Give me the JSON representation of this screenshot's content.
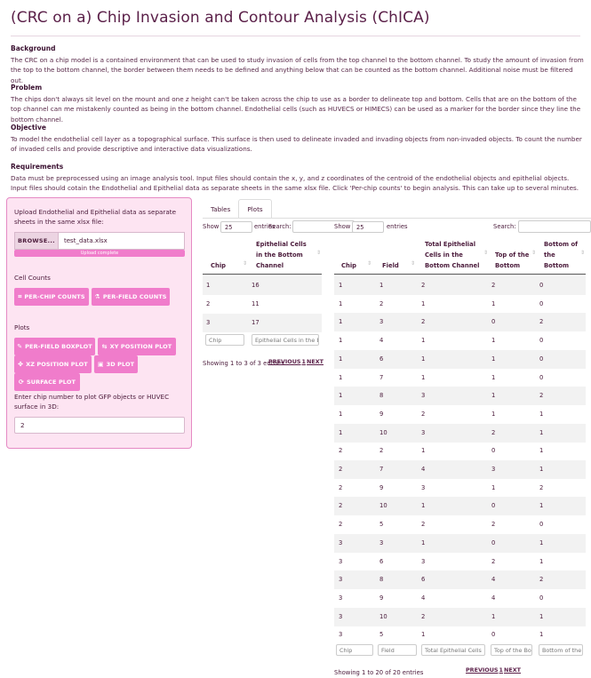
{
  "title": "(CRC on a) Chip Invasion and Contour Analysis (ChICA)",
  "sections": [
    {
      "heading": "Background",
      "text": "The CRC on a chip model is a contained environment that can be used to study invasion of cells from the top channel to the bottom channel. To study the amount of invasion from the top to the bottom channel, the border between them needs to be defined and anything below that can be counted as the bottom channel. Additional noise must be filtered out."
    },
    {
      "heading": "Problem",
      "text": "The chips don't always sit level on the mount and one z height can't be taken across the chip to use as a border to delineate top and bottom. Cells that are on the bottom of the top channel can me mistakenly counted as being in the bottom channel. Endothelial cells (such as HUVECS or HIMECS) can be used as a marker for the border since they line the bottom channel."
    },
    {
      "heading": "Objective",
      "text": "To model the endothelial cell layer as a topographical surface. This surface is then used to delineate invaded and invading objects from non-invaded objects. To count the number of invaded cells and provide descriptive and interactive data visualizations."
    },
    {
      "heading": "Requirements",
      "text": "Data must be preprocessed using an image analysis tool. Input files should contain the x, y, and z coordinates of the centroid of the endothelial objects and epithelial objects. Input files should cotain the Endothelial and Epithelial data as separate sheets in the same xlsx file. Click 'Per-chip counts' to begin analysis. This can take up to several minutes."
    }
  ],
  "sidebar": {
    "upload_label": "Upload Endothelial and Epithelial data as separate sheets in the same xlsx file:",
    "browse_label": "BROWSE...",
    "file_name": "test_data.xlsx",
    "progress_text": "Upload complete",
    "progress": 1.0,
    "cell_counts_label": "Cell Counts",
    "per_chip_label": "PER-CHIP COUNTS",
    "per_field_label": "PER-FIELD COUNTS",
    "plots_label": "Plots",
    "boxplot_label": "PER-FIELD BOXPLOT",
    "xy_label": "XY POSITION PLOT",
    "xz_label": "XZ POSITION PLOT",
    "plot3d_label": "3D PLOT",
    "surface_label": "SURFACE PLOT",
    "chip_prompt": "Enter chip number to plot GFP objects or HUVEC surface in 3D:",
    "chip_value": "2"
  },
  "tabs": [
    {
      "label": "Tables"
    },
    {
      "label": "Plots"
    }
  ],
  "table1": {
    "show_label": "Show",
    "show_value": "25",
    "entries_label": "entries",
    "search_label": "Search:",
    "headers": [
      "Chip",
      "Epithelial Cells in the Bottom Channel"
    ],
    "rows": [
      [
        "1",
        "16"
      ],
      [
        "2",
        "11"
      ],
      [
        "3",
        "17"
      ]
    ],
    "filters": [
      "Chip",
      "Epithelial Cells in the B"
    ],
    "info": "Showing 1 to 3 of 3 entries",
    "prev": "PREVIOUS",
    "page": "1",
    "next": "NEXT"
  },
  "table2": {
    "show_label": "Show",
    "show_value": "25",
    "entries_label": "entries",
    "search_label": "Search:",
    "headers": [
      "Chip",
      "Field",
      "Total Epithelial Cells in the Bottom Channel",
      "Top of the Bottom",
      "Bottom of the Bottom"
    ],
    "rows": [
      [
        "1",
        "1",
        "2",
        "2",
        "0"
      ],
      [
        "1",
        "2",
        "1",
        "1",
        "0"
      ],
      [
        "1",
        "3",
        "2",
        "0",
        "2"
      ],
      [
        "1",
        "4",
        "1",
        "1",
        "0"
      ],
      [
        "1",
        "6",
        "1",
        "1",
        "0"
      ],
      [
        "1",
        "7",
        "1",
        "1",
        "0"
      ],
      [
        "1",
        "8",
        "3",
        "1",
        "2"
      ],
      [
        "1",
        "9",
        "2",
        "1",
        "1"
      ],
      [
        "1",
        "10",
        "3",
        "2",
        "1"
      ],
      [
        "2",
        "2",
        "1",
        "0",
        "1"
      ],
      [
        "2",
        "7",
        "4",
        "3",
        "1"
      ],
      [
        "2",
        "9",
        "3",
        "1",
        "2"
      ],
      [
        "2",
        "10",
        "1",
        "0",
        "1"
      ],
      [
        "2",
        "5",
        "2",
        "2",
        "0"
      ],
      [
        "3",
        "3",
        "1",
        "0",
        "1"
      ],
      [
        "3",
        "6",
        "3",
        "2",
        "1"
      ],
      [
        "3",
        "8",
        "6",
        "4",
        "2"
      ],
      [
        "3",
        "9",
        "4",
        "4",
        "0"
      ],
      [
        "3",
        "10",
        "2",
        "1",
        "1"
      ],
      [
        "3",
        "5",
        "1",
        "0",
        "1"
      ]
    ],
    "filters": [
      "Chip",
      "Field",
      "Total Epithelial Cells",
      "Top of the Bo",
      "Bottom of the"
    ],
    "info": "Showing 1 to 20 of 20 entries",
    "prev": "PREVIOUS",
    "page": "1",
    "next": "NEXT"
  }
}
